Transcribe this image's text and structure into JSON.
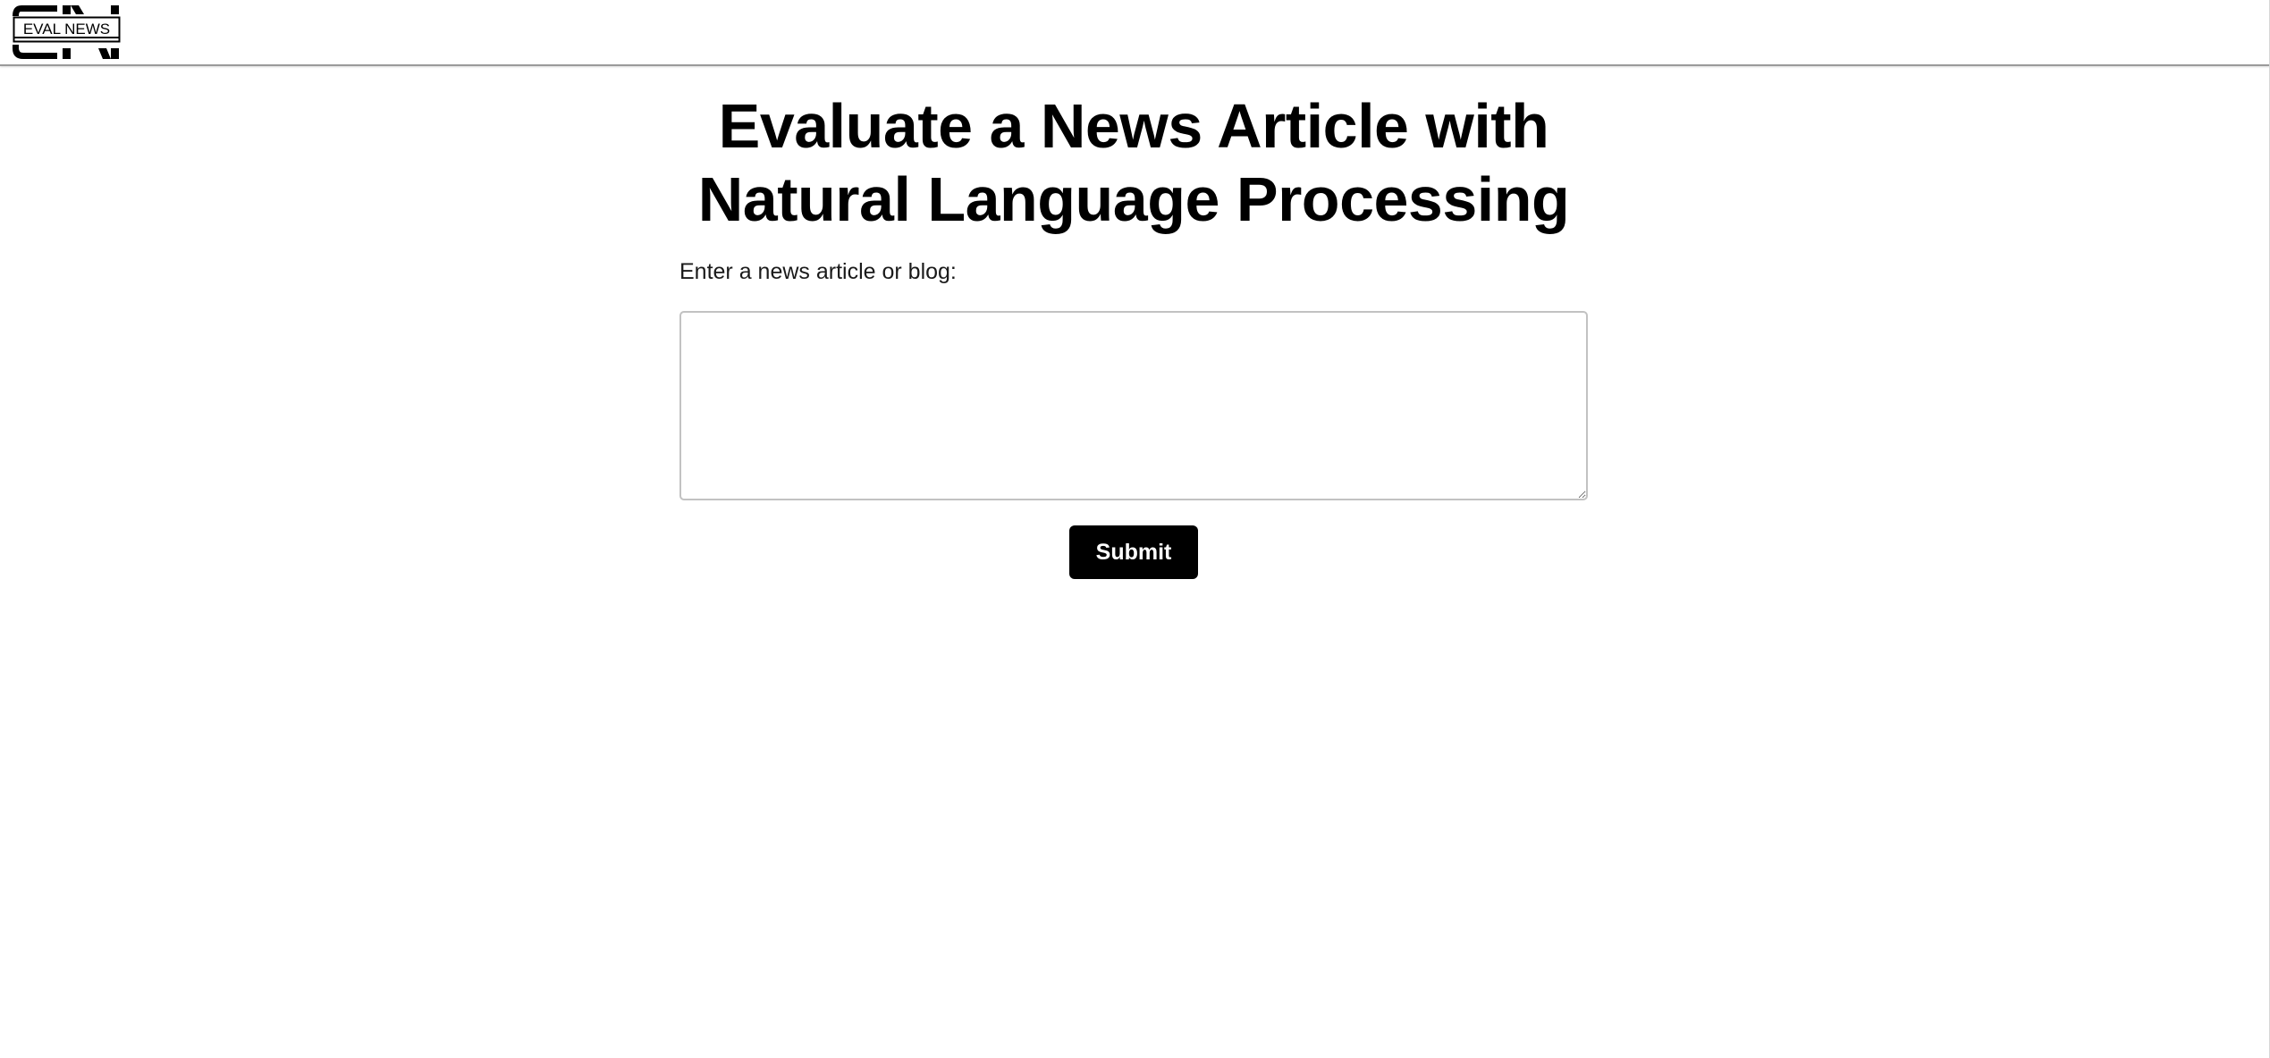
{
  "header": {
    "logo_text": "EVAL NEWS",
    "logo_letters": "EN"
  },
  "main": {
    "title": "Evaluate a News Article with Natural Language Processing",
    "input_label": "Enter a news article or blog:",
    "input_value": "",
    "input_placeholder": "",
    "submit_label": "Submit"
  },
  "colors": {
    "background": "#ffffff",
    "text": "#000000",
    "button_bg": "#000000",
    "button_text": "#ffffff",
    "header_border": "#9a9a9a"
  }
}
